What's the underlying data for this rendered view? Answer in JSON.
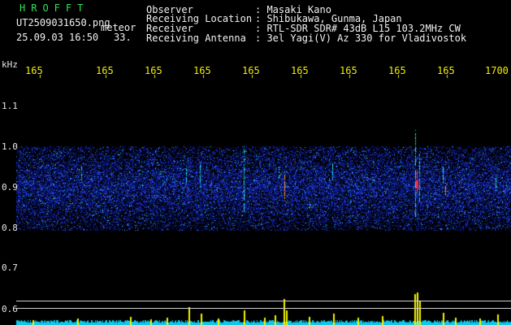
{
  "header": {
    "app_title": "HROFFT",
    "filename": "UT2509031650.png",
    "mode": "meteor",
    "datetime": "25.09.03 16:50",
    "count": "33.",
    "observer_label": "Observer",
    "observer_value": ": Masaki Kano",
    "location_label": "Receiving Location",
    "location_value": ": Shibukawa, Gunma, Japan",
    "receiver_label": "Receiver",
    "receiver_value": ": RTL-SDR SDR# 43dB L15 103.2MHz CW",
    "antenna_label": "Receiving Antenna",
    "antenna_value": ": 3el Yagi(V) Az 330 for Vladivostok"
  },
  "time_axis": {
    "ticks": [
      "165",
      "165",
      "165",
      "165",
      "165",
      "165",
      "165",
      "165",
      "165",
      "1700"
    ]
  },
  "freq_axis": {
    "unit": "kHz",
    "ticks": [
      "1.1",
      "1.0",
      "0.9",
      "0.8",
      "0.7",
      "0.6"
    ]
  },
  "colors": {
    "background": "#000000",
    "text": "#f2f2f2",
    "title_green": "#2fe35a",
    "tick_yellow": "#f2ee00",
    "noise_blue": "#1a2fd0",
    "signal_cyan": "#22e0e0",
    "signal_red": "#ff2040",
    "trace_yellow": "#f5f500",
    "trace_cyan": "#10c8e8"
  }
}
